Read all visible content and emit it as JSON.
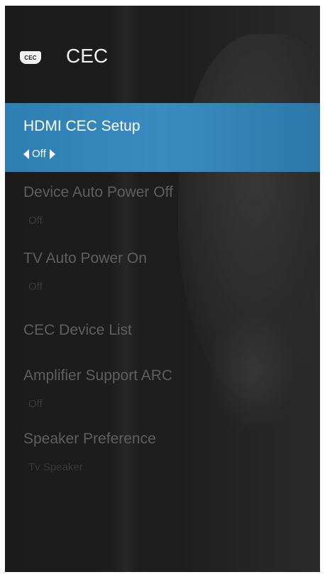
{
  "header": {
    "icon_text": "CEC",
    "title": "CEC"
  },
  "menu": {
    "items": [
      {
        "label": "HDMI CEC Setup",
        "value": "Off",
        "selected": true
      },
      {
        "label": "Device Auto Power Off",
        "value": "Off"
      },
      {
        "label": "TV Auto Power On",
        "value": "Off"
      },
      {
        "label": "CEC Device List"
      },
      {
        "label": "Amplifier Support ARC",
        "value": "Off"
      },
      {
        "label": "Speaker Preference",
        "value": "Tv Speaker"
      }
    ]
  },
  "colors": {
    "selected_bg": "#3a8cc0",
    "screen_bg": "#1e1e1e",
    "dim_text": "#5f5f5f"
  }
}
